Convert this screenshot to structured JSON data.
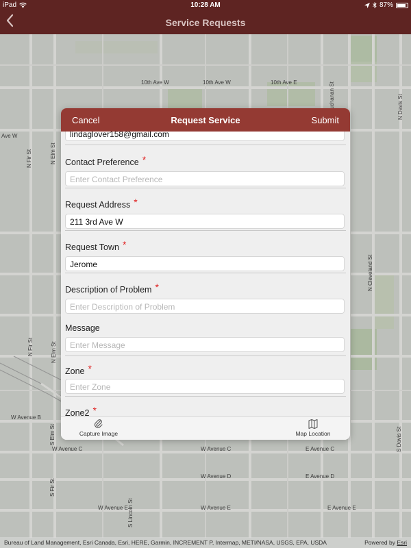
{
  "status_bar": {
    "device": "iPad",
    "time": "10:28 AM",
    "battery": "87%",
    "battery_level": 0.87
  },
  "nav": {
    "title": "Service Requests",
    "back_icon": "chevron-left-icon"
  },
  "map": {
    "streets": {
      "tenth_a": "10th Ave W",
      "tenth_b": "10th Ave W",
      "tenth_c": "10th Ave E",
      "ave_w_left": "Ave W",
      "w_ave_b": "W Avenue B",
      "w_ave_c_left": "W Avenue C",
      "w_ave_c_right": "W Avenue C",
      "e_ave_c": "E Avenue C",
      "w_ave_d": "W Avenue D",
      "e_ave_d": "E Avenue D",
      "w_ave_e_left": "W Avenue E",
      "w_ave_e_right": "W Avenue E",
      "e_ave_e": "E Avenue E",
      "n_fir_top": "N Fir St",
      "n_elm_top": "N Elm St",
      "n_fir_mid": "N Fir St",
      "n_elm_mid": "N Elm St",
      "s_elm": "S Elm St",
      "s_fir": "S Fir St",
      "buchanan": "Buchanan St",
      "n_davis": "N Davis St",
      "n_cleveland": "N Cleveland St",
      "s_davis": "S Davis St",
      "s_lincoln": "S Lincoln St"
    },
    "attribution": "Bureau of Land Management, Esri Canada, Esri, HERE, Garmin, INCREMENT P, Intermap, METI/NASA, USGS, EPA, USDA",
    "powered_prefix": "Powered by ",
    "powered_brand": "Esri"
  },
  "modal": {
    "cancel_label": "Cancel",
    "title": "Request Service",
    "submit_label": "Submit",
    "required_marker": "*",
    "fields": {
      "email": {
        "value": "lindaglover158@gmail.com"
      },
      "contact_preference": {
        "label": "Contact Preference",
        "placeholder": "Enter Contact Preference"
      },
      "request_address": {
        "label": "Request Address",
        "value": "211 3rd Ave W"
      },
      "request_town": {
        "label": "Request Town",
        "value": "Jerome"
      },
      "description": {
        "label": "Description of Problem",
        "placeholder": "Enter Description of Problem"
      },
      "message": {
        "label": "Message",
        "placeholder": "Enter Message"
      },
      "zone": {
        "label": "Zone",
        "placeholder": "Enter Zone"
      },
      "zone2": {
        "label": "Zone2"
      }
    },
    "footer": {
      "capture_image": "Capture Image",
      "map_location": "Map Location"
    }
  },
  "colors": {
    "nav_bar": "#5e2422",
    "modal_header": "#943a33",
    "required": "#e02020"
  }
}
